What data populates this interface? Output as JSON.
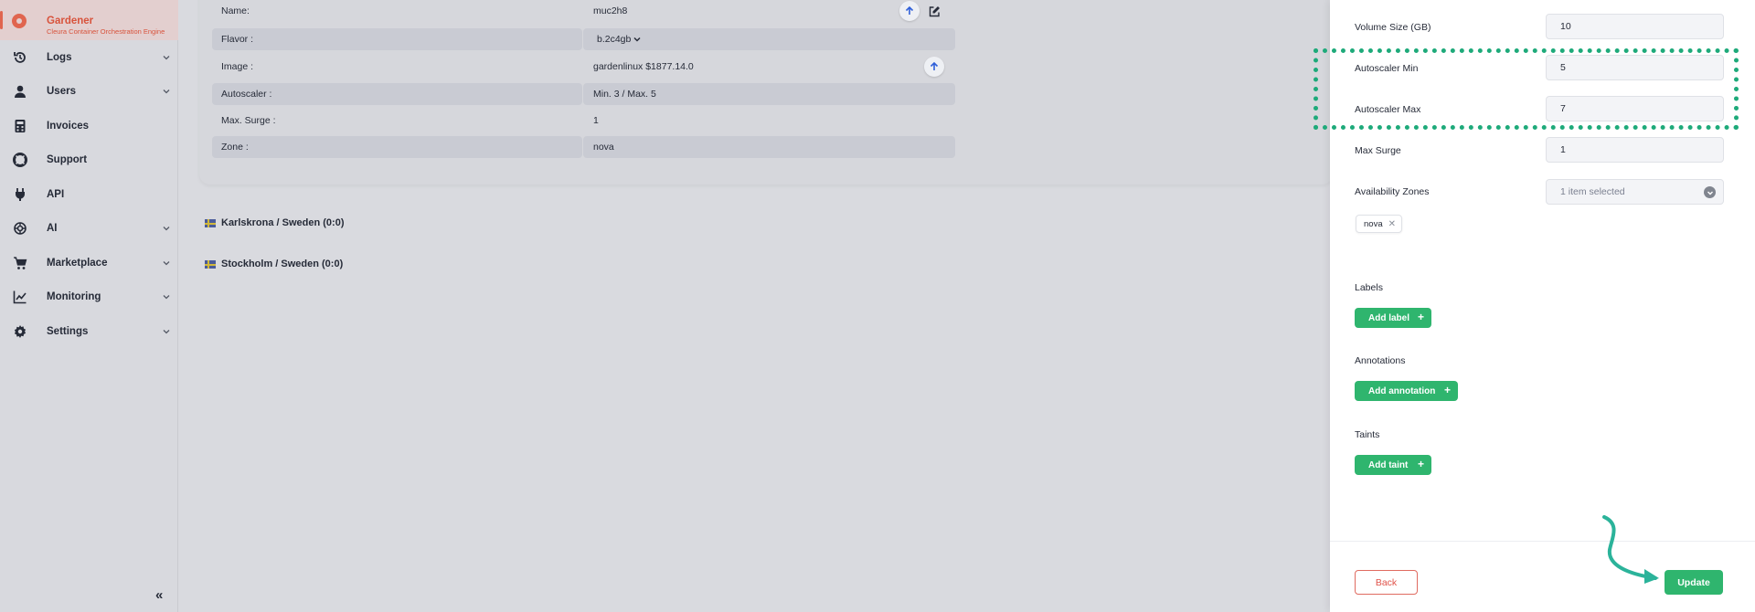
{
  "sidebar": {
    "brand_title": "Gardener",
    "brand_subtitle": "Cleura Container Orchestration Engine",
    "items": [
      {
        "label": "Logs",
        "icon": "history-icon",
        "expandable": true
      },
      {
        "label": "Users",
        "icon": "user-icon",
        "expandable": true
      },
      {
        "label": "Invoices",
        "icon": "calculator-icon",
        "expandable": false
      },
      {
        "label": "Support",
        "icon": "lifebuoy-icon",
        "expandable": false
      },
      {
        "label": "API",
        "icon": "plug-icon",
        "expandable": false
      },
      {
        "label": "AI",
        "icon": "ai-brain-icon",
        "expandable": true
      },
      {
        "label": "Marketplace",
        "icon": "cart-icon",
        "expandable": true
      },
      {
        "label": "Monitoring",
        "icon": "chart-line-icon",
        "expandable": true
      },
      {
        "label": "Settings",
        "icon": "gear-icon",
        "expandable": true
      }
    ],
    "collapse_label": "«"
  },
  "worker_details": {
    "rows": [
      {
        "label": "Name:",
        "value": "muc2h8"
      },
      {
        "label": "Flavor :",
        "value": "b.2c4gb"
      },
      {
        "label": "Image :",
        "value": "gardenlinux $1877.14.0"
      },
      {
        "label": "Autoscaler :",
        "value": "Min. 3 / Max. 5"
      },
      {
        "label": "Max. Surge :",
        "value": "1"
      },
      {
        "label": "Zone :",
        "value": "nova"
      }
    ]
  },
  "regions": [
    {
      "label": "Karlskrona / Sweden (0:0)"
    },
    {
      "label": "Stockholm / Sweden (0:0)"
    }
  ],
  "panel": {
    "fields": [
      {
        "label": "Volume Size (GB)",
        "value": "10"
      },
      {
        "label": "Autoscaler Min",
        "value": "5"
      },
      {
        "label": "Autoscaler Max",
        "value": "7"
      },
      {
        "label": "Max Surge",
        "value": "1"
      }
    ],
    "availability_zones": {
      "label": "Availability Zones",
      "selected_text": "1 item selected",
      "chips": [
        "nova"
      ]
    },
    "labels": {
      "title": "Labels",
      "button": "Add label"
    },
    "annotations": {
      "title": "Annotations",
      "button": "Add annotation"
    },
    "taints": {
      "title": "Taints",
      "button": "Add taint"
    },
    "back_label": "Back",
    "update_label": "Update"
  },
  "colors": {
    "accent_green": "#2fb56e",
    "brand_red": "#e0654f",
    "highlight": "#1eaa7a"
  }
}
